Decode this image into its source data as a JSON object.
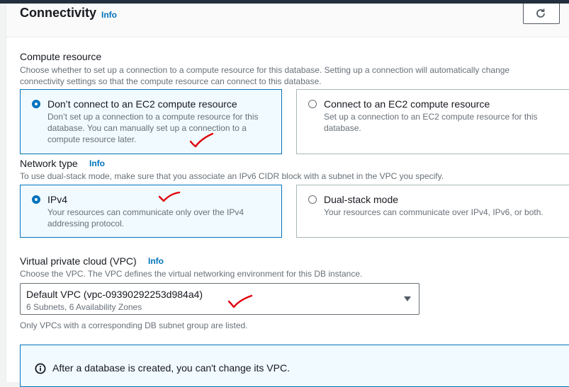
{
  "section": {
    "title": "Connectivity",
    "info": "Info",
    "refresh_icon": "refresh-icon"
  },
  "compute": {
    "label": "Compute resource",
    "description": "Choose whether to set up a connection to a compute resource for this database. Setting up a connection will automatically change connectivity settings so that the compute resource can connect to this database.",
    "options": [
      {
        "title": "Don’t connect to an EC2 compute resource",
        "description": "Don’t set up a connection to a compute resource for this database. You can manually set up a connection to a compute resource later.",
        "selected": true
      },
      {
        "title": "Connect to an EC2 compute resource",
        "description": "Set up a connection to an EC2 compute resource for this database.",
        "selected": false
      }
    ]
  },
  "network": {
    "label": "Network type",
    "info": "Info",
    "description": "To use dual-stack mode, make sure that you associate an IPv6 CIDR block with a subnet in the VPC you specify.",
    "options": [
      {
        "title": "IPv4",
        "description": "Your resources can communicate only over the IPv4 addressing protocol.",
        "selected": true
      },
      {
        "title": "Dual-stack mode",
        "description": "Your resources can communicate over IPv4, IPv6, or both.",
        "selected": false
      }
    ]
  },
  "vpc": {
    "label": "Virtual private cloud (VPC)",
    "info": "Info",
    "description": "Choose the VPC. The VPC defines the virtual networking environment for this DB instance.",
    "selected_value": "Default VPC (vpc-09390292253d984a4)",
    "selected_detail": "6 Subnets, 6 Availability Zones",
    "constraint": "Only VPCs with a corresponding DB subnet group are listed."
  },
  "alert": {
    "icon": "info-circle-icon",
    "text": "After a database is created, you can't change its VPC."
  },
  "colors": {
    "accent": "#0073bb",
    "annotation": "#e0000b"
  }
}
